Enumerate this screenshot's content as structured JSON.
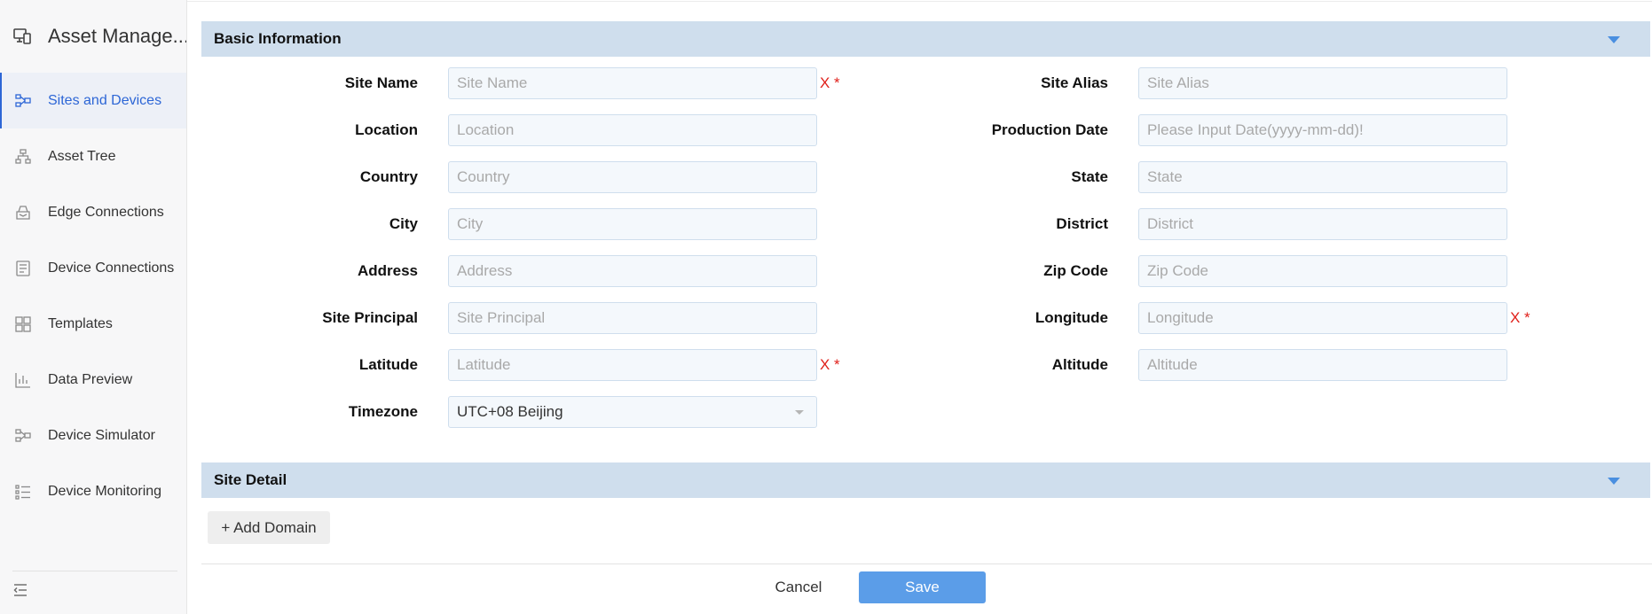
{
  "app": {
    "title": "Asset Manage..."
  },
  "sidebar": {
    "items": [
      {
        "label": "Sites and Devices",
        "icon": "sites-devices-icon",
        "active": true
      },
      {
        "label": "Asset Tree",
        "icon": "asset-tree-icon",
        "active": false
      },
      {
        "label": "Edge Connections",
        "icon": "edge-connections-icon",
        "active": false
      },
      {
        "label": "Device Connections",
        "icon": "device-connections-icon",
        "active": false
      },
      {
        "label": "Templates",
        "icon": "templates-icon",
        "active": false
      },
      {
        "label": "Data Preview",
        "icon": "data-preview-icon",
        "active": false
      },
      {
        "label": "Device Simulator",
        "icon": "device-simulator-icon",
        "active": false
      },
      {
        "label": "Device Monitoring",
        "icon": "device-monitoring-icon",
        "active": false
      }
    ],
    "collapse_icon": "collapse-menu-icon"
  },
  "basic_info": {
    "title": "Basic Information",
    "fields": {
      "site_name": {
        "label": "Site Name",
        "placeholder": "Site Name",
        "required_mark": "X *"
      },
      "site_alias": {
        "label": "Site Alias",
        "placeholder": "Site Alias"
      },
      "location": {
        "label": "Location",
        "placeholder": "Location"
      },
      "production_date": {
        "label": "Production Date",
        "placeholder": "Please Input Date(yyyy-mm-dd)!"
      },
      "country": {
        "label": "Country",
        "placeholder": "Country"
      },
      "state": {
        "label": "State",
        "placeholder": "State"
      },
      "city": {
        "label": "City",
        "placeholder": "City"
      },
      "district": {
        "label": "District",
        "placeholder": "District"
      },
      "address": {
        "label": "Address",
        "placeholder": "Address"
      },
      "zip_code": {
        "label": "Zip Code",
        "placeholder": "Zip Code"
      },
      "site_principal": {
        "label": "Site Principal",
        "placeholder": "Site Principal"
      },
      "longitude": {
        "label": "Longitude",
        "placeholder": "Longitude",
        "required_mark": "X *"
      },
      "latitude": {
        "label": "Latitude",
        "placeholder": "Latitude",
        "required_mark": "X *"
      },
      "altitude": {
        "label": "Altitude",
        "placeholder": "Altitude"
      },
      "timezone": {
        "label": "Timezone",
        "value": "UTC+08 Beijing"
      }
    }
  },
  "site_detail": {
    "title": "Site Detail",
    "add_domain_label": "+ Add Domain"
  },
  "actions": {
    "cancel_label": "Cancel",
    "save_label": "Save"
  },
  "colors": {
    "accent": "#2d66d6",
    "section_bg": "#cfdeed",
    "save_bg": "#5b9de8",
    "required": "#e0201a"
  }
}
